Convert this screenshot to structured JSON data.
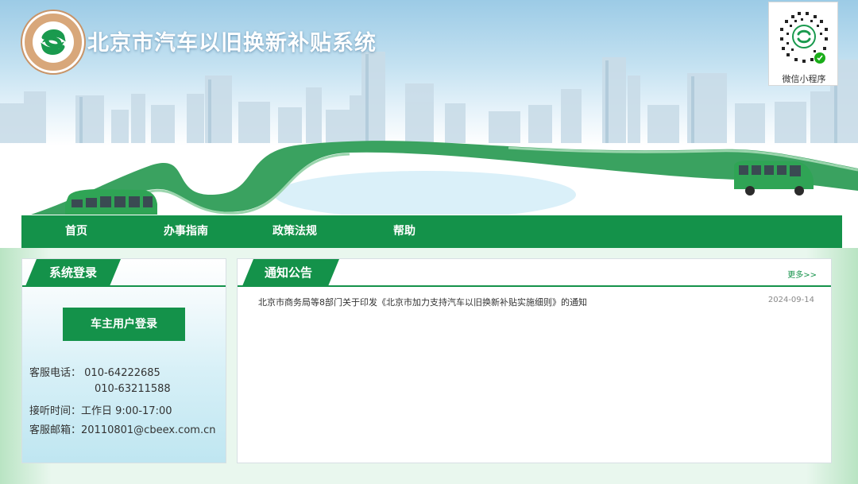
{
  "header": {
    "title": "北京市汽车以旧换新补贴系统",
    "qr_label": "微信小程序",
    "logo_icon": "cbeex-logo-icon"
  },
  "nav": {
    "items": [
      {
        "label": "首页"
      },
      {
        "label": "办事指南"
      },
      {
        "label": "政策法规"
      },
      {
        "label": "帮助"
      }
    ]
  },
  "login": {
    "heading": "系统登录",
    "button_label": "车主用户登录",
    "phone_label": "客服电话：",
    "phone_1": "010-64222685",
    "phone_2": "010-63211588",
    "hours_label": "接听时间：",
    "hours_value": "工作日 9:00-17:00",
    "email_label": "客服邮箱：",
    "email_value": "20110801@cbeex.com.cn"
  },
  "notices": {
    "heading": "通知公告",
    "more_label": "更多>>",
    "items": [
      {
        "title": "北京市商务局等8部门关于印发《北京市加力支持汽车以旧换新补贴实施细则》的通知",
        "date": "2024-09-14"
      }
    ]
  },
  "colors": {
    "brand_green": "#14924a",
    "logo_tan": "#d8a77a"
  }
}
